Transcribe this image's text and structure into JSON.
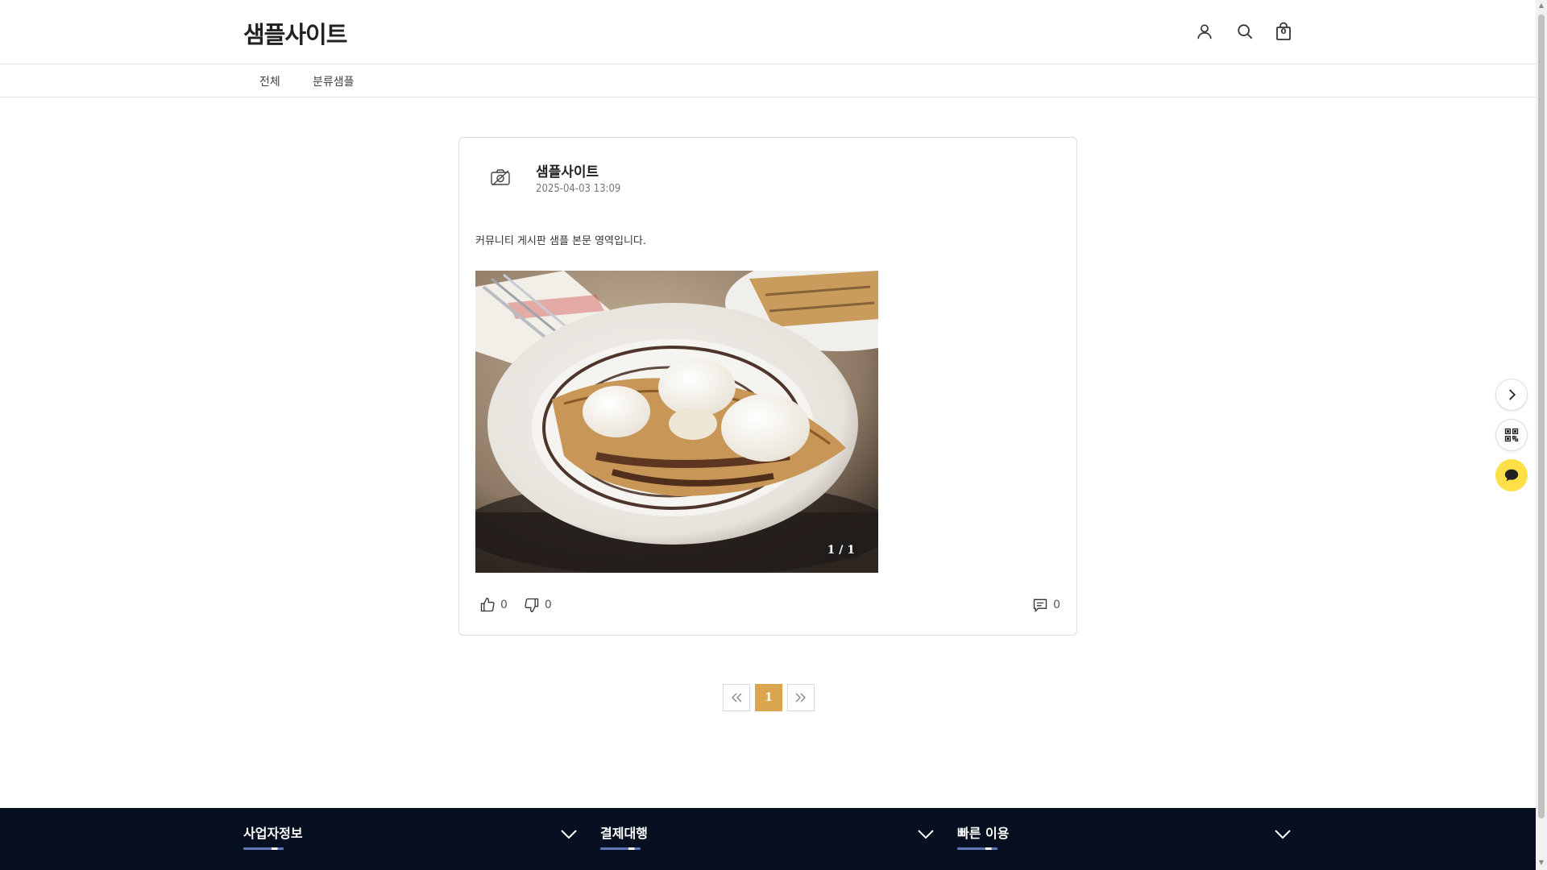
{
  "header": {
    "logo": "샘플사이트",
    "cart_count": "0"
  },
  "categories": [
    {
      "label": "전체"
    },
    {
      "label": "분류샘플"
    }
  ],
  "post": {
    "author": "샘플사이트",
    "date": "2025-04-03 13:09",
    "content": "커뮤니티 게시판 샘플 본문 영역입니다.",
    "image_counter": "1 / 1",
    "likes": "0",
    "dislikes": "0",
    "comments": "0"
  },
  "pagination": {
    "pages": [
      "1"
    ],
    "current": "1"
  },
  "footer": {
    "sections": [
      {
        "title": "사업자정보"
      },
      {
        "title": "결제대행"
      },
      {
        "title": "빠른 이용"
      }
    ]
  },
  "colors": {
    "accent": "#d9a54f",
    "footer_bg": "#061020",
    "chat_yellow": "#fde047"
  },
  "icons": {
    "user": "user-icon",
    "search": "search-icon",
    "cart": "shopping-bag-icon",
    "avatar": "camera-off-icon",
    "like": "thumbs-up-icon",
    "dislike": "thumbs-down-icon",
    "comment": "comment-icon",
    "next": "chevron-right-icon",
    "qr": "qr-code-icon",
    "chat": "chat-bubble-icon"
  }
}
